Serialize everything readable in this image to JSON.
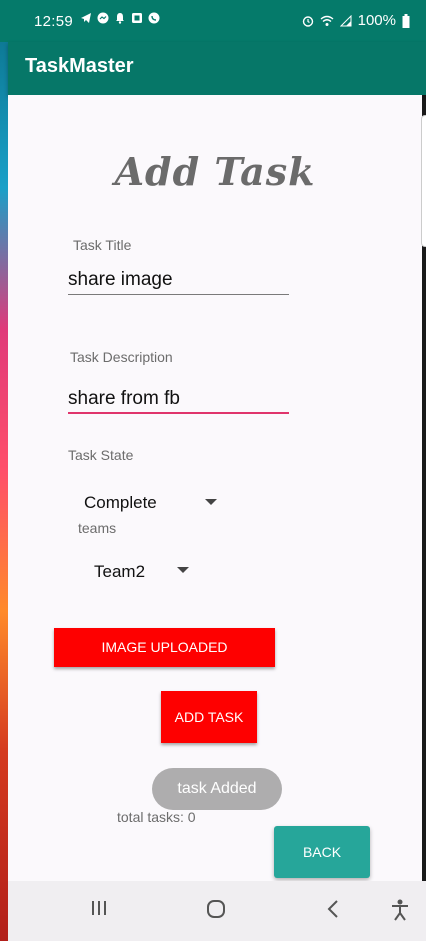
{
  "status_bar": {
    "time": "12:59",
    "battery": "100%",
    "left_icons": [
      "telegram-icon",
      "messenger-icon",
      "notification-bell-icon",
      "square-app-icon",
      "whatsapp-icon"
    ],
    "right_icons": [
      "alarm-icon",
      "wifi-icon",
      "signal-icon",
      "battery-icon"
    ]
  },
  "app_bar": {
    "title": "TaskMaster"
  },
  "form": {
    "heading": "Add Task",
    "title_label": "Task Title",
    "title_value": "share image",
    "description_label": "Task Description",
    "description_value": "share from fb",
    "state_label": "Task State",
    "state_value": "Complete",
    "teams_label": "teams",
    "team_value": "Team2",
    "image_button": "IMAGE UPLOADED",
    "add_button": "ADD TASK",
    "total_tasks": "total tasks: 0",
    "back_button": "BACK"
  },
  "toast": {
    "message": "task Added"
  },
  "colors": {
    "primary": "#067768",
    "accent": "#e0356c",
    "red_button": "#fe0000",
    "back_button": "#26a69a"
  }
}
